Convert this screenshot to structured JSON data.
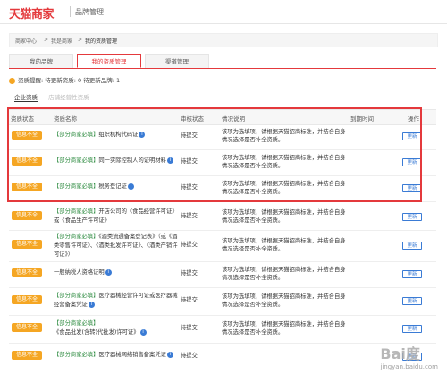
{
  "header": {
    "logo": "天猫商家",
    "subtitle": "品牌管理"
  },
  "breadcrumb": [
    "商家中心",
    ">",
    "我是商家",
    ">",
    "我的资质管理"
  ],
  "tabs": [
    {
      "label": "我的品牌",
      "active": false
    },
    {
      "label": "我的资质管理",
      "active": true
    },
    {
      "label": "渠道管理",
      "active": false
    }
  ],
  "notice": {
    "text": "资质提醒:  待更新资质: 0   待更新品牌: 1"
  },
  "subtabs": [
    {
      "label": "企业资质",
      "active": true
    },
    {
      "label": "店铺经营性资质",
      "active": false
    }
  ],
  "table": {
    "headers": [
      "资质状态",
      "资质名称",
      "审核状态",
      "情况说明",
      "到期时间",
      "操作"
    ],
    "rows": [
      {
        "badge": "信息不全",
        "req": "【部分商家必填】",
        "name": "组织机构代码证",
        "status": "待提交",
        "desc": "该项为选填项，请根据天猫招商标准，并结合自身情况选择是否补全资质。",
        "action": "更新"
      },
      {
        "badge": "信息不全",
        "req": "【部分商家必填】",
        "name": "同一实际控制人的证明材料",
        "status": "待提交",
        "desc": "该项为选填项，请根据天猫招商标准，并结合自身情况选择是否补全资质。",
        "action": "更新"
      },
      {
        "badge": "信息不全",
        "req": "【部分商家必填】",
        "name": "税务登记证",
        "status": "待提交",
        "desc": "该项为选填项，请根据天猫招商标准，并结合自身情况选择是否补全资质。",
        "action": "更新"
      },
      {
        "badge": "信息不全",
        "req": "【部分商家必填】",
        "name": "开店公司的《食品经营许可证》或《食品生产许可证》",
        "status": "待提交",
        "desc": "该项为选填项，请根据天猫招商标准，并结合自身情况选择是否补全资质。",
        "action": "更新"
      },
      {
        "badge": "信息不全",
        "req": "【部分商家必填】",
        "name": "《酒类流通备案登记表》（或《酒类零售许可证》、《酒类批发许可证》、《酒类产销许可证》）",
        "status": "待提交",
        "desc": "该项为选填项，请根据天猫招商标准，并结合自身情况选择是否补全资质。",
        "action": "更新"
      },
      {
        "badge": "信息不全",
        "req": "",
        "name": "一般纳税人资格证明",
        "status": "待提交",
        "desc": "该项为选填项，请根据天猫招商标准，并结合自身情况选择是否补全资质。",
        "action": "更新"
      },
      {
        "badge": "信息不全",
        "req": "【部分商家必填】",
        "name": "医疗器械经营许可证或医疗器械经营备案凭证",
        "status": "待提交",
        "desc": "该项为选填项，请根据天猫招商标准，并结合自身情况选择是否补全资质。",
        "action": "更新"
      },
      {
        "badge": "信息不全",
        "req": "【部分商家必填】",
        "name": "《食品批发(含转)代批发)许可证》",
        "status": "待提交",
        "desc": "该项为选填项，请根据天猫招商标准，并结合自身情况选择是否补全资质。",
        "action": "更新"
      },
      {
        "badge": "信息不全",
        "req": "【部分商家必填】",
        "name": "医疗器械网络销售备案凭证",
        "status": "待提交",
        "desc": "",
        "action": "更新"
      }
    ]
  },
  "watermark": {
    "main": "Bai度",
    "sub": "jingyan.baidu.com"
  }
}
